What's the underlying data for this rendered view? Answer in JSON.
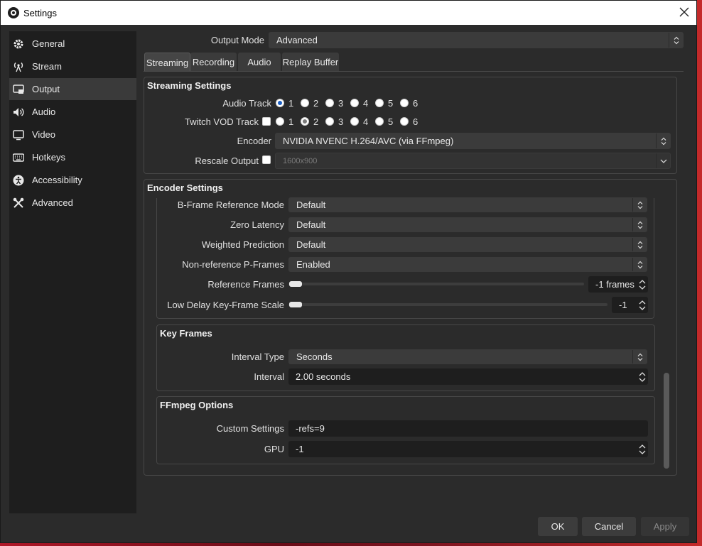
{
  "window": {
    "title": "Settings"
  },
  "sidebar": {
    "items": [
      {
        "label": "General",
        "icon": "gear-icon"
      },
      {
        "label": "Stream",
        "icon": "antenna-icon"
      },
      {
        "label": "Output",
        "icon": "output-icon"
      },
      {
        "label": "Audio",
        "icon": "speaker-icon"
      },
      {
        "label": "Video",
        "icon": "monitor-icon"
      },
      {
        "label": "Hotkeys",
        "icon": "keyboard-icon"
      },
      {
        "label": "Accessibility",
        "icon": "accessibility-icon"
      },
      {
        "label": "Advanced",
        "icon": "tools-icon"
      }
    ],
    "active_index": 2
  },
  "output_mode": {
    "label": "Output Mode",
    "value": "Advanced"
  },
  "tabs": [
    {
      "label": "Streaming",
      "active": true
    },
    {
      "label": "Recording",
      "active": false
    },
    {
      "label": "Audio",
      "active": false
    },
    {
      "label": "Replay Buffer",
      "active": false
    }
  ],
  "streaming_settings": {
    "title": "Streaming Settings",
    "audio_track": {
      "label": "Audio Track",
      "options": [
        "1",
        "2",
        "3",
        "4",
        "5",
        "6"
      ],
      "selected": "1"
    },
    "twitch_vod": {
      "label": "Twitch VOD Track",
      "checked": false,
      "options": [
        "1",
        "2",
        "3",
        "4",
        "5",
        "6"
      ],
      "selected": "2"
    },
    "encoder": {
      "label": "Encoder",
      "value": "NVIDIA NVENC H.264/AVC (via FFmpeg)"
    },
    "rescale": {
      "label": "Rescale Output",
      "checked": false,
      "value": "1600x900"
    }
  },
  "encoder_settings": {
    "title": "Encoder Settings",
    "bframe_ref": {
      "label": "B-Frame Reference Mode",
      "value": "Default"
    },
    "zero_latency": {
      "label": "Zero Latency",
      "value": "Default"
    },
    "weighted_pred": {
      "label": "Weighted Prediction",
      "value": "Default"
    },
    "nonref_pframes": {
      "label": "Non-reference P-Frames",
      "value": "Enabled"
    },
    "ref_frames": {
      "label": "Reference Frames",
      "value": "-1 frames",
      "slider_level": 0
    },
    "low_delay": {
      "label": "Low Delay Key-Frame Scale",
      "value": "-1",
      "slider_level": 0
    }
  },
  "key_frames": {
    "title": "Key Frames",
    "interval_type": {
      "label": "Interval Type",
      "value": "Seconds"
    },
    "interval": {
      "label": "Interval",
      "value": "2.00 seconds"
    }
  },
  "ffmpeg_options": {
    "title": "FFmpeg Options",
    "custom": {
      "label": "Custom Settings",
      "value": "-refs=9"
    },
    "gpu": {
      "label": "GPU",
      "value": "-1"
    }
  },
  "buttons": {
    "ok": "OK",
    "cancel": "Cancel",
    "apply": "Apply"
  },
  "colors": {
    "accent": "#1b5fc4",
    "window_bg": "#2b2b2b",
    "sidebar_bg": "#1e1e1e"
  }
}
